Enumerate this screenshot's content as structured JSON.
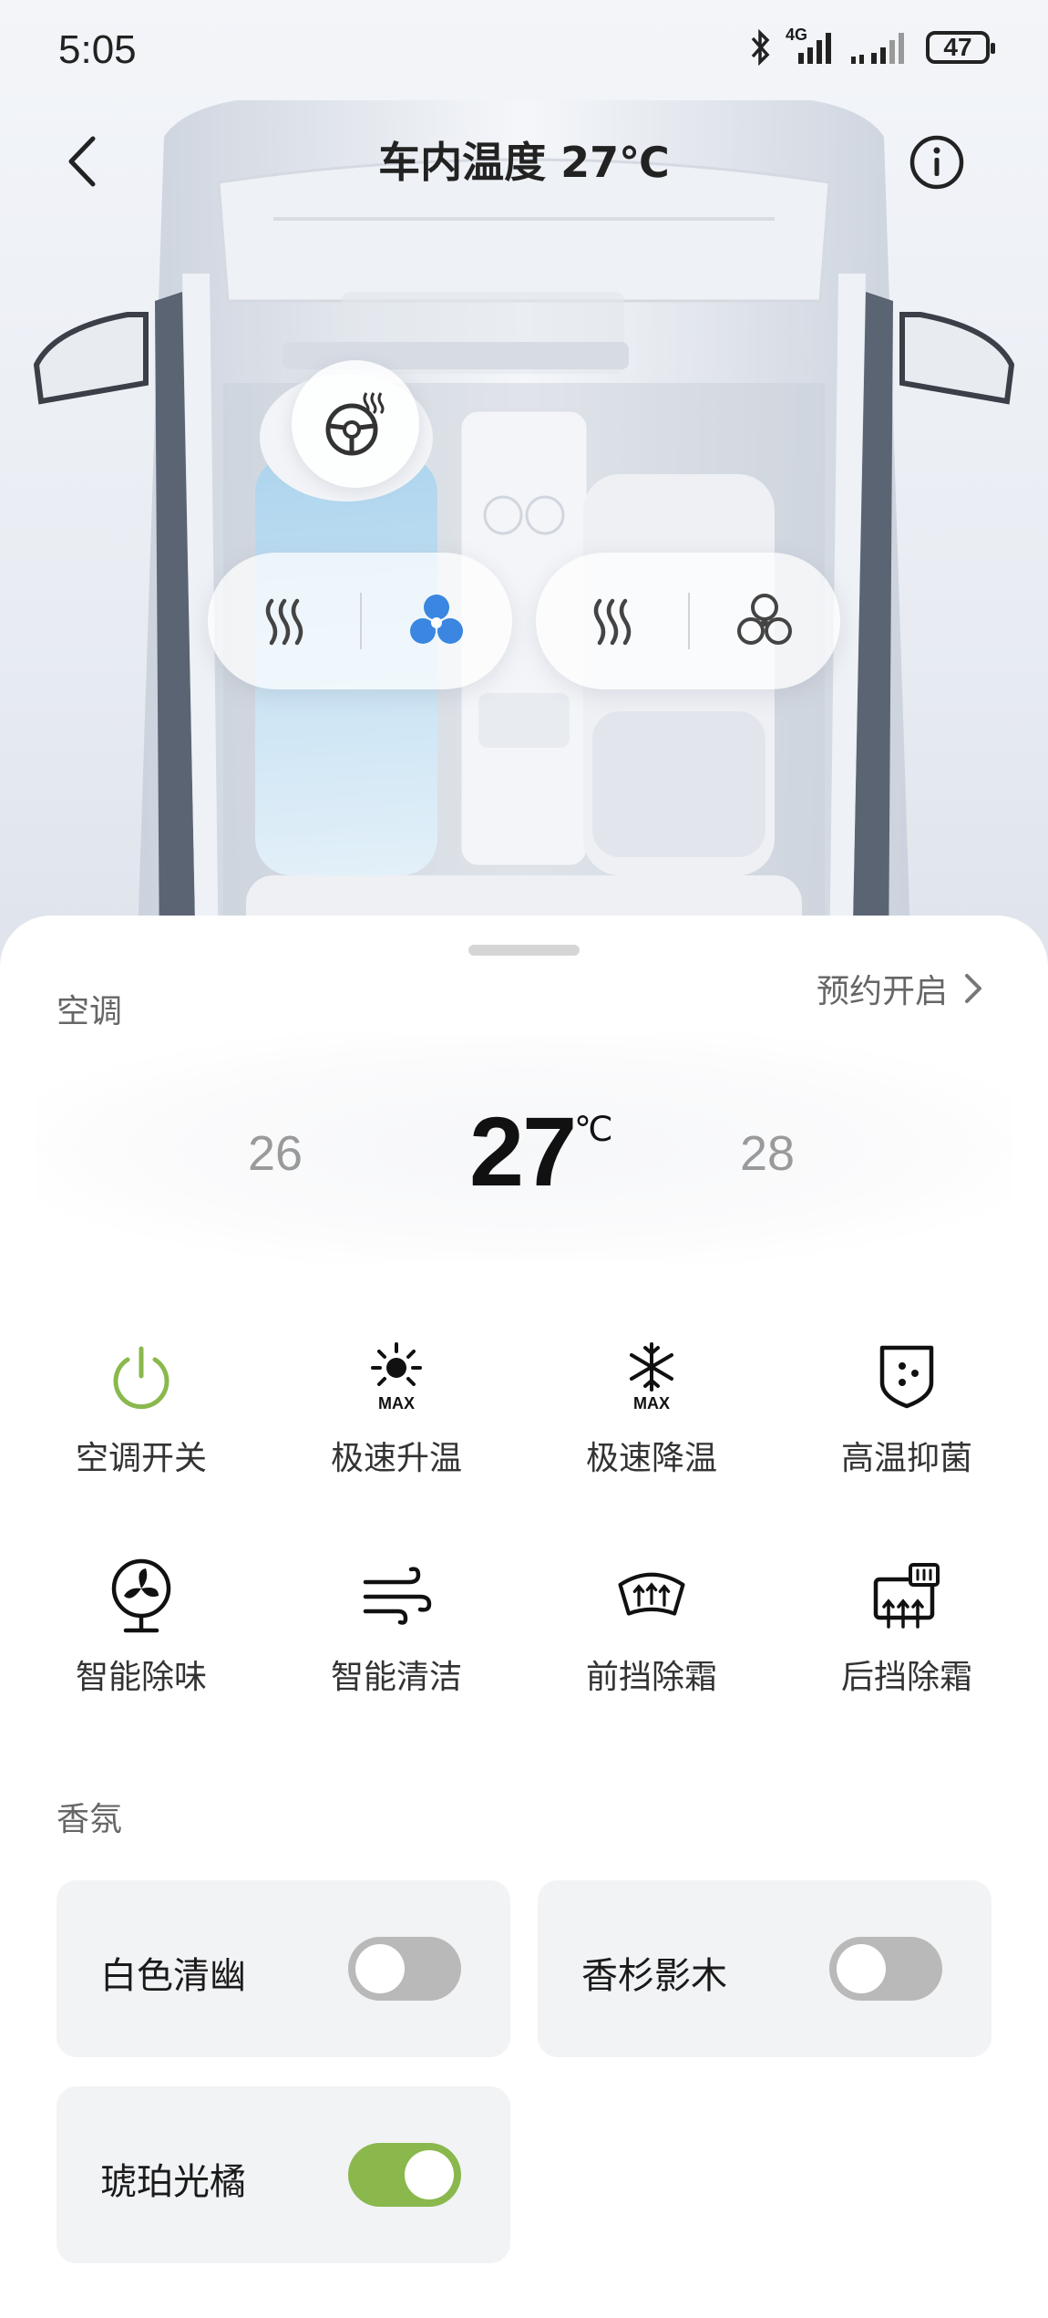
{
  "status_bar": {
    "time": "5:05",
    "network": "4G",
    "battery": "47"
  },
  "header": {
    "title": "车内温度 27℃"
  },
  "climate": {
    "section_label": "空调",
    "schedule_label": "预约开启",
    "temp_prev": "26",
    "temp_current": "27",
    "temp_unit": "℃",
    "temp_next": "28"
  },
  "functions": [
    {
      "label": "空调开关",
      "icon": "power-icon"
    },
    {
      "label": "极速升温",
      "icon": "sun-max-icon"
    },
    {
      "label": "极速降温",
      "icon": "snowflake-max-icon"
    },
    {
      "label": "高温抑菌",
      "icon": "shield-germ-icon"
    },
    {
      "label": "智能除味",
      "icon": "fan-deodorize-icon"
    },
    {
      "label": "智能清洁",
      "icon": "wind-clean-icon"
    },
    {
      "label": "前挡除霜",
      "icon": "front-defrost-icon"
    },
    {
      "label": "后挡除霜",
      "icon": "rear-defrost-icon"
    }
  ],
  "fragrance": {
    "section_label": "香氛",
    "items": [
      {
        "label": "白色清幽",
        "enabled": false
      },
      {
        "label": "香杉影木",
        "enabled": false
      },
      {
        "label": "琥珀光橘",
        "enabled": true
      }
    ]
  },
  "colors": {
    "accent_green": "#8ab84d",
    "fan_blue": "#3a86e0",
    "seat_blue": "#bfe0f3"
  }
}
